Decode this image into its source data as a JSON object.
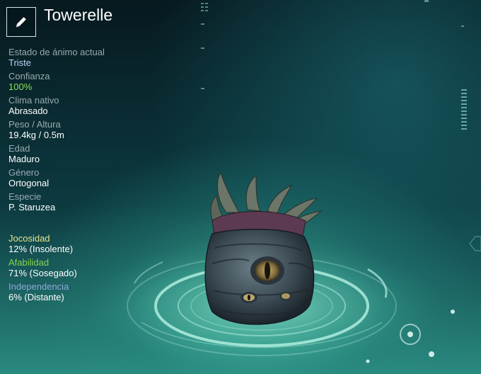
{
  "creature": {
    "name": "Towerelle"
  },
  "stats": [
    {
      "label": "Estado de ánimo actual",
      "value": "Triste"
    },
    {
      "label": "Confianza",
      "value": "100%"
    },
    {
      "label": "Clima nativo",
      "value": "Abrasado"
    },
    {
      "label": "Peso / Altura",
      "value": "19.4kg / 0.5m"
    },
    {
      "label": "Edad",
      "value": "Maduro"
    },
    {
      "label": "Género",
      "value": "Ortogonal"
    },
    {
      "label": "Especie",
      "value": "P. Staruzea"
    }
  ],
  "traits": [
    {
      "label": "Jocosidad",
      "value": "12% (Insolente)",
      "color": "#e6e48a"
    },
    {
      "label": "Afabilidad",
      "value": "71% (Sosegado)",
      "color": "#86d34e"
    },
    {
      "label": "Independencia",
      "value": "6% (Distante)",
      "color": "#8ea8d8"
    }
  ],
  "colors": {
    "mood_value": "#b8d0f4",
    "trust_value": "#8be05a",
    "label_gray": "#9aaab0",
    "ring_glow": "#9ff2dc"
  },
  "icons": {
    "edit": "pencil-icon"
  }
}
